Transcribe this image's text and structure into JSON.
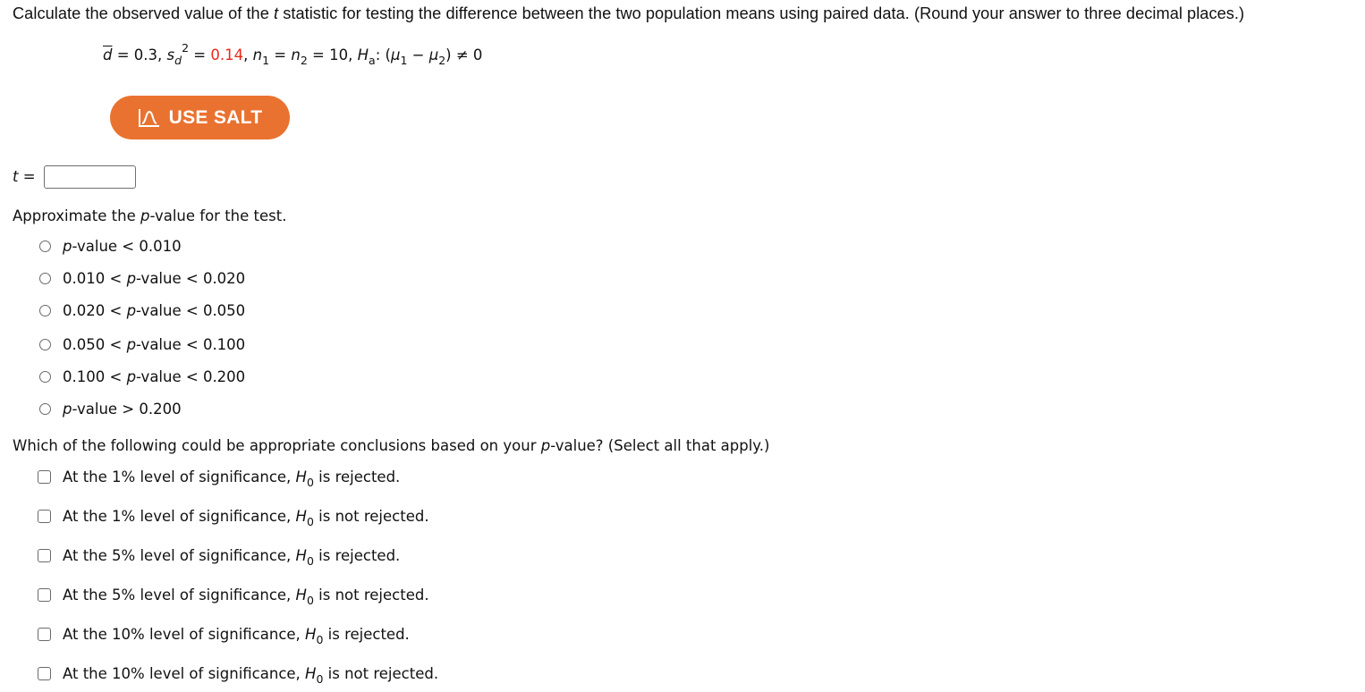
{
  "question": {
    "prompt_before_t": "Calculate the observed value of the ",
    "prompt_t": "t",
    "prompt_after_t": " statistic for testing the difference between the two population means using paired data. (Round your answer to three decimal places.)"
  },
  "given": {
    "dbar_symbol": "d",
    "dbar_value": " = 0.3, ",
    "sd_symbol": "s",
    "sd_sub": "d",
    "sd_sup": "2",
    "sd_eq": " = ",
    "sd_value": "0.14",
    "after_sd": ", ",
    "n1_symbol": "n",
    "n1_sub": "1",
    "n_eq": " = ",
    "n2_symbol": "n",
    "n2_sub": "2",
    "n_value": " = 10, ",
    "ha_symbol": "H",
    "ha_sub": "a",
    "ha_colon": ": (",
    "mu1_symbol": "μ",
    "mu1_sub": "1",
    "minus": " − ",
    "mu2_symbol": "μ",
    "mu2_sub": "2",
    "ha_tail": ") ≠ 0",
    "highlight_color": "#e8281c"
  },
  "salt_button": {
    "label": "USE SALT",
    "icon": "distribution-curve-icon",
    "color": "#ea7230"
  },
  "t_answer": {
    "label_var": "t",
    "label_eq": " =",
    "value": "",
    "placeholder": ""
  },
  "pvalue_question": {
    "before": "Approximate the ",
    "p": "p",
    "after": "-value for the test.",
    "options": [
      {
        "pre": "",
        "p": "p",
        "post": "-value < 0.010"
      },
      {
        "pre": "0.010 < ",
        "p": "p",
        "post": "-value < 0.020"
      },
      {
        "pre": "0.020 < ",
        "p": "p",
        "post": "-value < 0.050"
      },
      {
        "pre": "0.050 < ",
        "p": "p",
        "post": "-value < 0.100"
      },
      {
        "pre": "0.100 < ",
        "p": "p",
        "post": "-value < 0.200"
      },
      {
        "pre": "",
        "p": "p",
        "post": "-value > 0.200"
      }
    ]
  },
  "conclusion_question": {
    "before": "Which of the following could be appropriate conclusions based on your ",
    "p": "p",
    "after": "-value? (Select all that apply.)",
    "options": [
      {
        "pre": "At the 1% level of significance, ",
        "h": "H",
        "sub": "0",
        "post": " is rejected."
      },
      {
        "pre": "At the 1% level of significance, ",
        "h": "H",
        "sub": "0",
        "post": " is not rejected."
      },
      {
        "pre": "At the 5% level of significance, ",
        "h": "H",
        "sub": "0",
        "post": " is rejected."
      },
      {
        "pre": "At the 5% level of significance, ",
        "h": "H",
        "sub": "0",
        "post": " is not rejected."
      },
      {
        "pre": "At the 10% level of significance, ",
        "h": "H",
        "sub": "0",
        "post": " is rejected."
      },
      {
        "pre": "At the 10% level of significance, ",
        "h": "H",
        "sub": "0",
        "post": " is not rejected."
      }
    ]
  }
}
